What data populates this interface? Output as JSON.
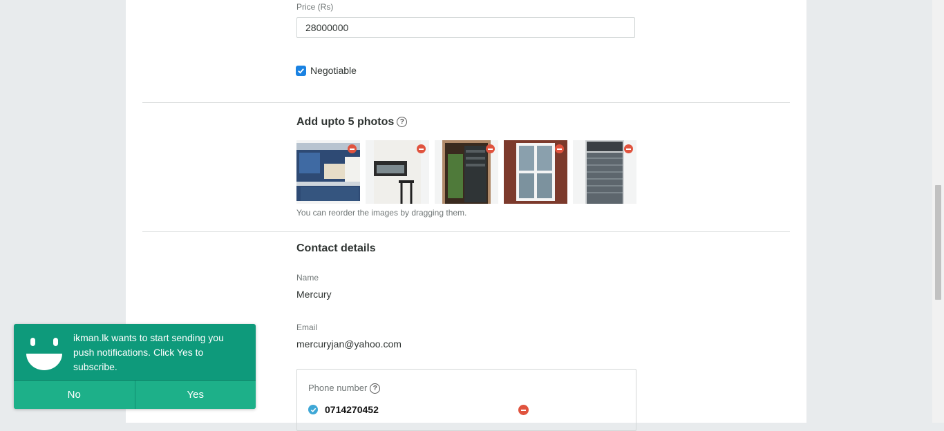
{
  "price": {
    "label": "Price (Rs)",
    "value": "28000000",
    "negotiable_label": "Negotiable",
    "negotiable_checked": true
  },
  "photos": {
    "title": "Add upto 5 photos",
    "help_icon": "question-circle-icon",
    "hint": "You can reorder the images by dragging them.",
    "items": [
      {
        "subject": "kitchen-with-blue-cabinets"
      },
      {
        "subject": "wall-mounted-window"
      },
      {
        "subject": "steel-door"
      },
      {
        "subject": "white-sash-window"
      },
      {
        "subject": "metal-roller-door"
      }
    ],
    "remove_icon": "minus-circle-icon"
  },
  "contact": {
    "title": "Contact details",
    "name_label": "Name",
    "name_value": "Mercury",
    "email_label": "Email",
    "email_value": "mercuryjan@yahoo.com",
    "phone_label": "Phone number",
    "phone_value": "0714270452",
    "phone_verified_icon": "check-circle-icon"
  },
  "notification": {
    "message": "ikman.lk wants to start sending you push notifications. Click Yes to subscribe.",
    "no_label": "No",
    "yes_label": "Yes",
    "bg_color": "#0e9a7b",
    "button_color": "#1db089"
  },
  "colors": {
    "remove": "#e0533e",
    "checkbox": "#1a82e2"
  }
}
